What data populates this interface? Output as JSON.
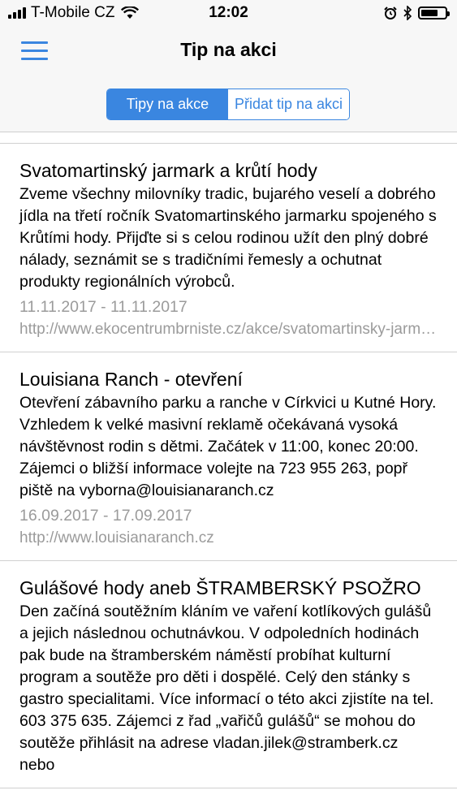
{
  "status_bar": {
    "carrier": "T-Mobile CZ",
    "time": "12:02"
  },
  "nav": {
    "title": "Tip na akci",
    "segments": [
      "Tipy na akce",
      "Přidat tip na akci"
    ],
    "selected_segment": "Tipy na akce"
  },
  "events": [
    {
      "title": "Svatomartinský jarmark a krůtí hody",
      "description": "Zveme všechny milovníky tradic, bujarého veselí a dobrého jídla na třetí ročník Svatomartinského jarmarku spojeného s Krůtími hody. Přijďte si s celou rodinou užít den plný dobré nálady, seznámit se s tradičními řemesly a ochutnat produkty regionálních výrobců.",
      "dates": "11.11.2017 - 11.11.2017",
      "url": "http://www.ekocentrumbrniste.cz/akce/svatomartinsky-jarmark"
    },
    {
      "title": "Louisiana Ranch - otevření",
      "description": "Otevření zábavního parku a ranche v Církvici u Kutné Hory. Vzhledem k velké masivní reklamě očekávaná vysoká návštěvnost rodin s dětmi. Začátek v 11:00, konec 20:00. Zájemci o bližší informace volejte na 723 955 263, popř piště na vyborna@louisianaranch.cz",
      "dates": "16.09.2017 - 17.09.2017",
      "url": "http://www.louisianaranch.cz"
    },
    {
      "title": "Gulášové hody aneb ŠTRAMBERSKÝ PSOŽRO",
      "description": "Den začíná soutěžním kláním ve vaření kotlíkových gulášů a jejich následnou ochutnávkou. V odpoledních hodinách pak bude na štramberském náměstí probíhat kulturní program a soutěže pro děti i dospělé. Celý den stánky s gastro specialitami. Více informací o této akci zjistíte na tel. 603 375 635. Zájemci z řad „vařičů gulášů“ se mohou do soutěže přihlásit na adrese vladan.jilek@stramberk.cz nebo",
      "dates": "",
      "url": ""
    }
  ]
}
